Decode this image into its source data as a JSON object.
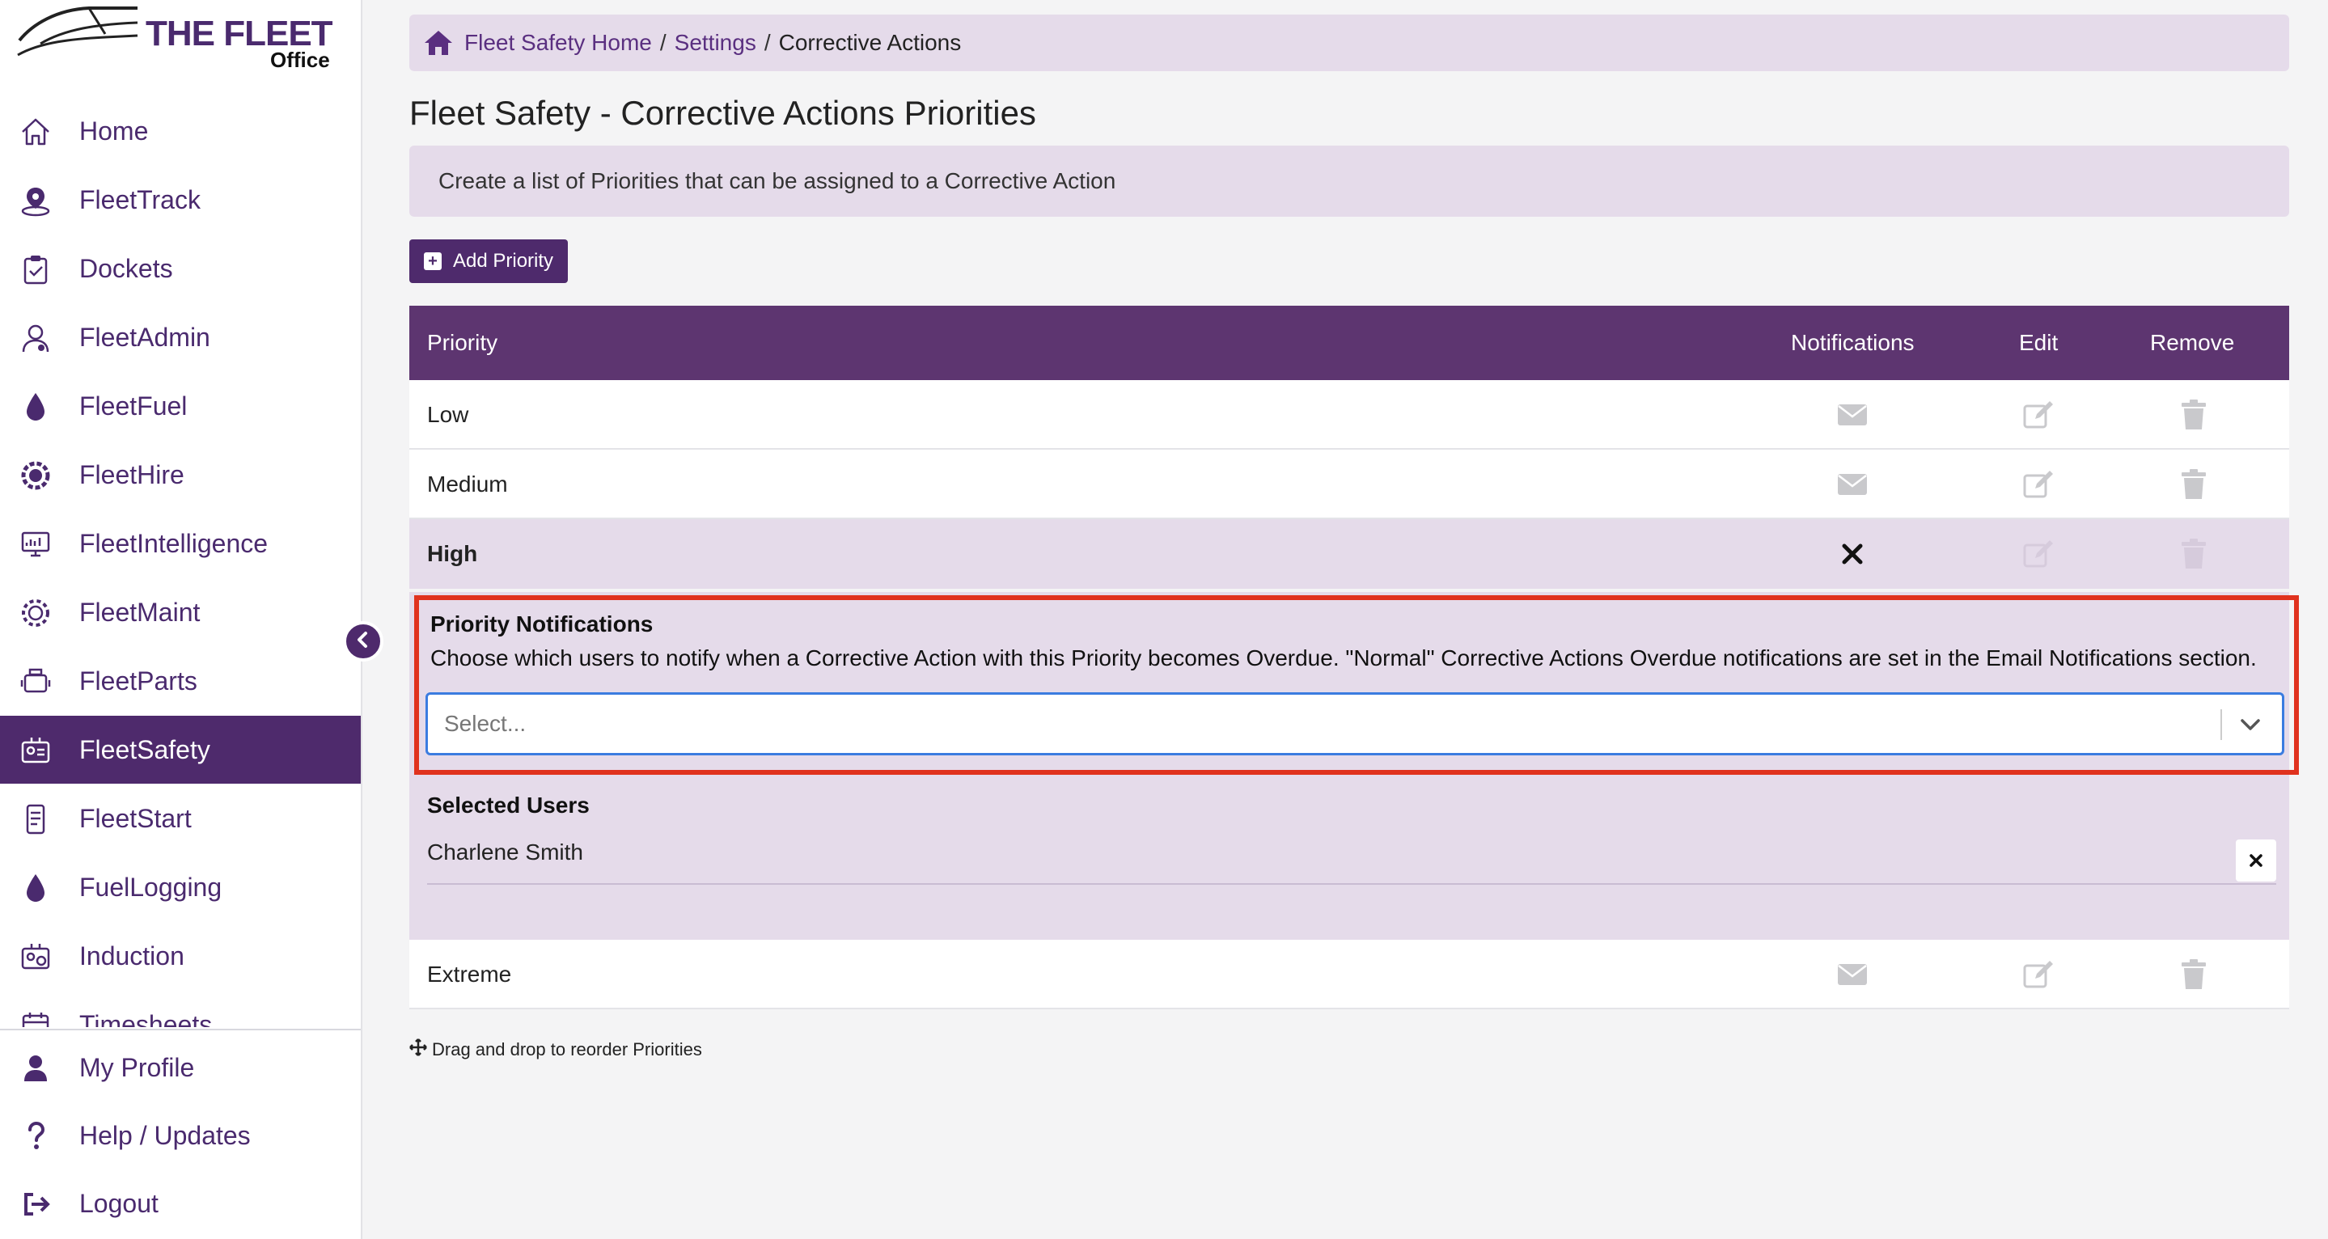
{
  "logo": {
    "title": "THE FLEET",
    "subtitle": "Office"
  },
  "sidebar": {
    "items": [
      {
        "label": "Home",
        "icon": "home-icon"
      },
      {
        "label": "FleetTrack",
        "icon": "map-pin-icon"
      },
      {
        "label": "Dockets",
        "icon": "clipboard-check-icon"
      },
      {
        "label": "FleetAdmin",
        "icon": "user-admin-icon"
      },
      {
        "label": "FleetFuel",
        "icon": "fuel-drop-icon"
      },
      {
        "label": "FleetHire",
        "icon": "hire-badge-icon"
      },
      {
        "label": "FleetIntelligence",
        "icon": "monitor-chart-icon"
      },
      {
        "label": "FleetMaint",
        "icon": "gear-wrench-icon"
      },
      {
        "label": "FleetParts",
        "icon": "engine-part-icon"
      },
      {
        "label": "FleetSafety",
        "icon": "safety-id-icon",
        "active": true
      },
      {
        "label": "FleetStart",
        "icon": "checklist-phone-icon"
      },
      {
        "label": "FuelLogging",
        "icon": "fuel-drop-icon"
      },
      {
        "label": "Induction",
        "icon": "id-card-icon"
      },
      {
        "label": "Timesheets",
        "icon": "calendar-icon"
      }
    ],
    "bottom": [
      {
        "label": "My Profile",
        "icon": "user-icon"
      },
      {
        "label": "Help / Updates",
        "icon": "question-icon"
      },
      {
        "label": "Logout",
        "icon": "logout-icon"
      }
    ]
  },
  "breadcrumb": {
    "home": "Fleet Safety Home",
    "sep": "/",
    "settings": "Settings",
    "current": "Corrective Actions"
  },
  "page": {
    "title": "Fleet Safety - Corrective Actions Priorities",
    "info": "Create a list of Priorities that can be assigned to a Corrective Action",
    "add_button": "Add Priority",
    "hint": "Drag and drop to reorder Priorities"
  },
  "table": {
    "headers": {
      "priority": "Priority",
      "notifications": "Notifications",
      "edit": "Edit",
      "remove": "Remove"
    },
    "rows": [
      {
        "label": "Low"
      },
      {
        "label": "Medium"
      },
      {
        "label": "High"
      },
      {
        "label": "Extreme"
      }
    ]
  },
  "notifications_panel": {
    "title": "Priority Notifications",
    "description": "Choose which users to notify when a Corrective Action with this Priority becomes Overdue. \"Normal\" Corrective Actions Overdue notifications are set in the Email Notifications section.",
    "select_placeholder": "Select...",
    "selected_users_title": "Selected Users",
    "selected_users": [
      "Charlene Smith"
    ]
  },
  "colors": {
    "brand_purple": "#4e2a6c",
    "header_purple": "#5d3570",
    "light_purple": "#e5dbea",
    "highlight_red": "#e0321e",
    "focus_blue": "#3b7ce0"
  }
}
